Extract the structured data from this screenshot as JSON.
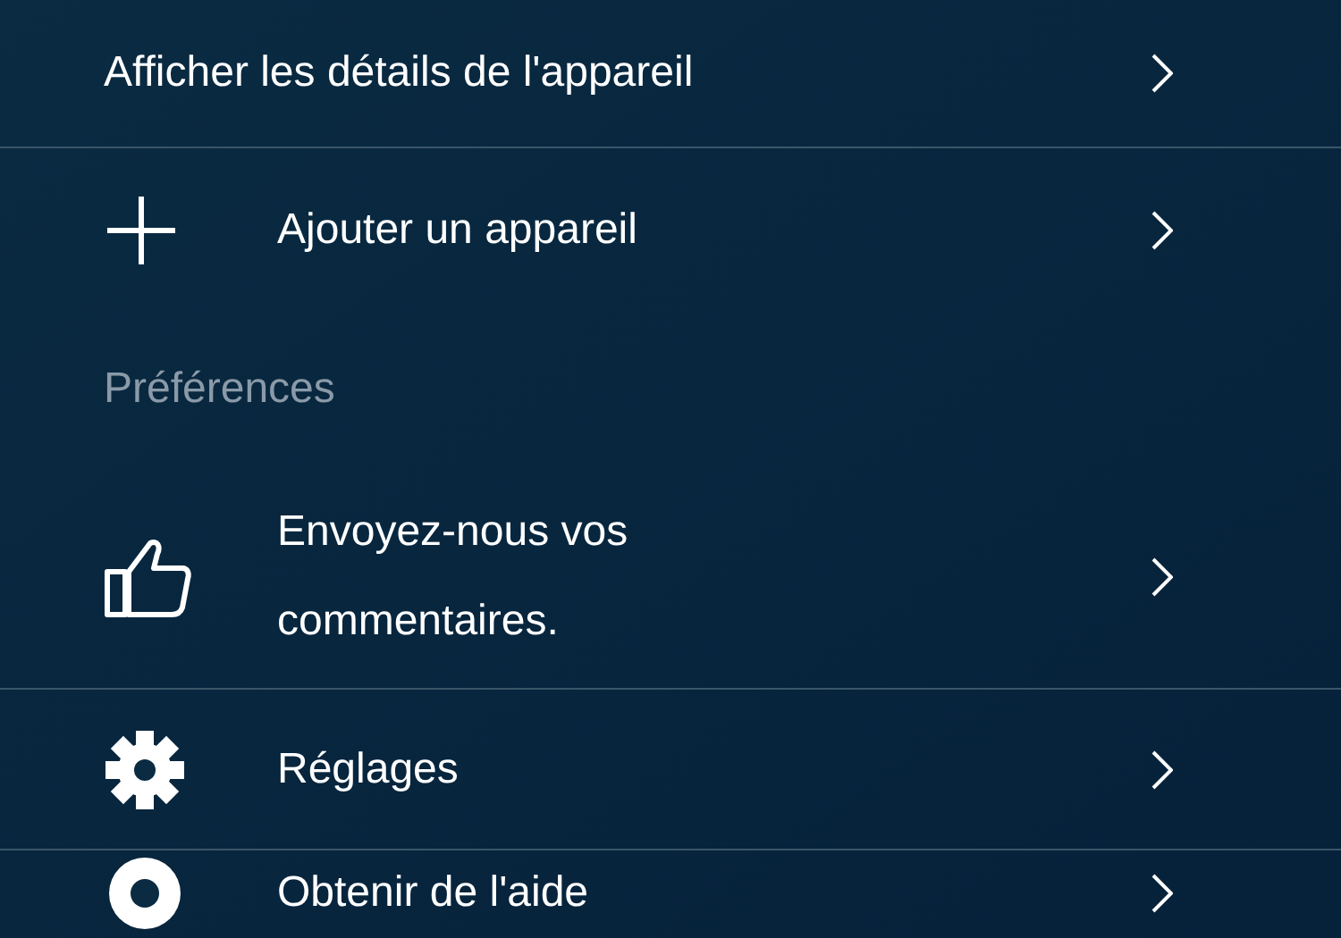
{
  "menu": [
    {
      "kind": "row",
      "label": "Afficher les détails de l'appareil"
    },
    {
      "kind": "row",
      "label": "Ajouter un appareil"
    },
    {
      "kind": "section",
      "label": "Préférences"
    },
    {
      "kind": "row",
      "label": "Envoyez-nous vos commentaires."
    },
    {
      "kind": "row",
      "label": "Réglages"
    },
    {
      "kind": "row",
      "label": "Obtenir de l'aide"
    }
  ]
}
